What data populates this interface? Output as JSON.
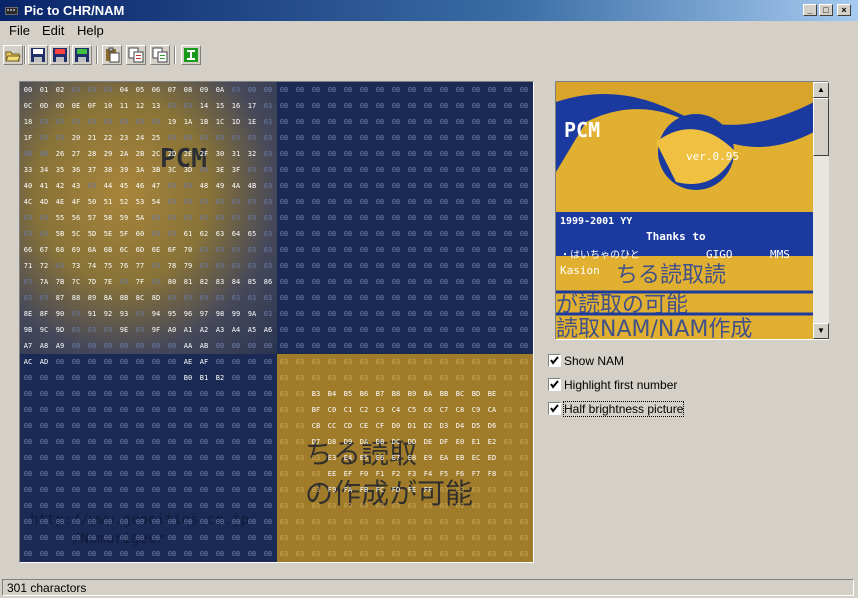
{
  "window": {
    "title": "Pic to CHR/NAM",
    "minimize": "_",
    "maximize": "□",
    "close": "×"
  },
  "menu": [
    "File",
    "Edit",
    "Help"
  ],
  "toolbar": {
    "buttons": [
      "open-icon",
      "save-icon",
      "save-chr-icon",
      "save-nam-icon",
      "paste-icon",
      "copy-icon",
      "copy-nam-icon",
      "convert-icon"
    ]
  },
  "colors": {
    "navy": "#1b2a55",
    "gold": "#a07c2a",
    "accent": "#0a246a"
  },
  "nam_grid": {
    "rows": [
      "00 01 02 03 03 03 04 05 06 07 08 09 0A 03 0B 0B 0B 0B 0B 0B 0B 0B 0B 0B 0B 0B 0B 0B 0B 0B 0B 0B",
      "0C 0D 0D 0E 0F 10 11 12 13 03 03 14 15 16 17 03 0B 0B 0B 0B 0B 0B 0B 0B 0B 0B 0B 0B 0B 0B 0B 0B",
      "18 03 03 03 03 03 03 03 03 19 1A 1B 1C 1D 1E 03 0B 0B 0B 0B 0B 0B 0B 0B 0B 0B 0B 0B 0B 0B 0B 0B",
      "1F 03 03 20 21 22 23 24 25 03 03 03 03 03 03 03 0B 0B 0B 0B 0B 0B 0B 0B 0B 0B 0B 0B 0B 0B 0B 0B",
      "0B 0B 26 27 28 29 2A 2B 2C 2D 2E 2F 30 31 32 03 0B 0B 0B 0B 0B 0B 0B 0B 0B 0B 0B 0B 0B 0B 0B 0B",
      "33 34 35 36 37 38 39 3A 3B 3C 3D 03 3E 3F 03 03 0B 0B 0B 0B 0B 0B 0B 0B 0B 0B 0B 0B 0B 0B 0B 0B",
      "40 41 42 43 03 44 45 46 47 03 03 48 49 4A 4B 03 0B 0B 0B 0B 0B 0B 0B 0B 0B 0B 0B 0B 0B 0B 0B 0B",
      "4C 4D 4E 4F 50 51 52 53 54 03 03 03 03 03 03 03 0B 0B 0B 0B 0B 0B 0B 0B 0B 0B 0B 0B 0B 0B 0B 0B",
      "03 03 55 56 57 58 59 5A 03 03 03 03 03 03 03 03 0B 0B 0B 0B 0B 0B 0B 0B 0B 0B 0B 0B 0B 0B 0B 0B",
      "03 03 5B 5C 5D 5E 5F 60 03 03 61 62 63 64 65 03 0B 0B 0B 0B 0B 0B 0B 0B 0B 0B 0B 0B 0B 0B 0B 0B",
      "66 67 68 69 6A 6B 6C 6D 6E 6F 70 03 03 03 03 03 0B 0B 0B 0B 0B 0B 0B 0B 0B 0B 0B 0B 0B 0B 0B 0B",
      "71 72 03 73 74 75 76 77 03 78 79 03 03 03 03 03 0B 0B 0B 0B 0B 0B 0B 0B 0B 0B 0B 0B 0B 0B 0B 0B",
      "03 7A 7B 7C 7D 7E 03 7F 03 80 81 82 83 84 85 86 0B 0B 0B 0B 0B 0B 0B 0B 0B 0B 0B 0B 0B 0B 0B 0B",
      "03 03 87 88 89 8A 8B 8C 8D 03 03 03 03 03 03 03 0B 0B 0B 0B 0B 0B 0B 0B 0B 0B 0B 0B 0B 0B 0B 0B",
      "8E 8F 90 03 91 92 93 03 94 95 96 97 98 99 9A 03 0B 0B 0B 0B 0B 0B 0B 0B 0B 0B 0B 0B 0B 0B 0B 0B",
      "9B 9C 9D 03 03 03 9E 03 9F A0 A1 A2 A3 A4 A5 A6 0B 0B 0B 0B 0B 0B 0B 0B 0B 0B 0B 0B 0B 0B 0B 0B",
      "A7 A8 A9 0B 0B 0B 0B 0B 0B 0B AA AB 0B 0B 0B 0B 0B 0B 0B 0B 0B 0B 0B 0B 0B 0B 0B 0B 0B 0B 0B 0B",
      "AC AD 0B 0B 0B 0B 0B 0B 0B 0B AE AF 0B 0B 0B 0B 03 03 03 03 03 03 03 03 03 03 03 03 03 03 03 03",
      "0B 0B 0B 0B 0B 0B 0B 0B 0B 0B B0 B1 B2 0B 0B 0B 03 03 03 03 03 03 03 03 03 03 03 03 03 03 03 03",
      "0B 0B 0B 0B 0B 0B 0B 0B 0B 0B 0B 0B 0B 0B 0B 0B 03 03 B3 B4 B5 B6 B7 B8 B9 BA BB BC BD BE 03 03",
      "0B 0B 0B 0B 0B 0B 0B 0B 0B 0B 0B 0B 0B 0B 0B 0B 03 03 BF C0 C1 C2 C3 C4 C5 C6 C7 C8 C9 CA 03 03",
      "0B 0B 0B 0B 0B 0B 0B 0B 0B 0B 0B 0B 0B 0B 0B 0B 03 03 CB CC CD CE CF D0 D1 D2 D3 D4 D5 D6 03 03",
      "0B 0B 0B 0B 0B 0B 0B 0B 0B 0B 0B 0B 0B 0B 0B 0B 03 03 D7 D8 D9 DA DB DC DD DE DF E0 E1 E2 03 03",
      "0B 0B 0B 0B 0B 0B 0B 0B 0B 0B 0B 0B 0B 0B 0B 0B 03 03 03 E3 E4 E5 E6 E7 E8 E9 EA EB EC ED 03 03",
      "0B 0B 0B 0B 0B 0B 0B 0B 0B 0B 0B 0B 0B 0B 0B 0B 03 03 03 EE EF F0 F1 F2 F3 F4 F5 F6 F7 F8 03 03",
      "0B 0B 0B 0B 0B 0B 0B 0B 0B 0B 0B 0B 0B 0B 0B 0B 03 03 03 F9 FA FB FC FD FE FF 03 03 03 03 03 03",
      "0B 0B 0B 0B 0B 0B 0B 0B 0B 0B 0B 0B 0B 0B 0B 0B 03 03 03 03 03 03 03 03 03 03 03 03 03 03 03 03",
      "0B 0B 0B 0B 0B 0B 0B 0B 0B 0B 0B 0B 0B 0B 0B 0B 03 03 03 03 03 03 03 03 03 03 03 03 03 03 03 03",
      "0B 0B 0B 0B 0B 0B 0B 0B 0B 0B 0B 0B 0B 0B 0B 0B 03 03 03 03 03 03 03 03 03 03 03 03 03 03 03 03",
      "0B 0B 0B 0B 0B 0B 0B 0B 0B 0B 0B 0B 0B 0B 0B 0B 03 03 03 03 03 03 03 03 03 03 03 03 03 03 03 03"
    ]
  },
  "preview": {
    "version": "ver.0.95",
    "years": "1999-2001 YY",
    "thanks": "Thanks to",
    "credit1": "・はいちゃのひと",
    "credit2": "GIGO",
    "credit3": "MMS",
    "credit4": "Kasion"
  },
  "options": [
    {
      "label": "Show NAM",
      "checked": true
    },
    {
      "label": "Highlight first number",
      "checked": true
    },
    {
      "label": "Half brightness picture",
      "checked": true
    }
  ],
  "status": "301 charactors"
}
